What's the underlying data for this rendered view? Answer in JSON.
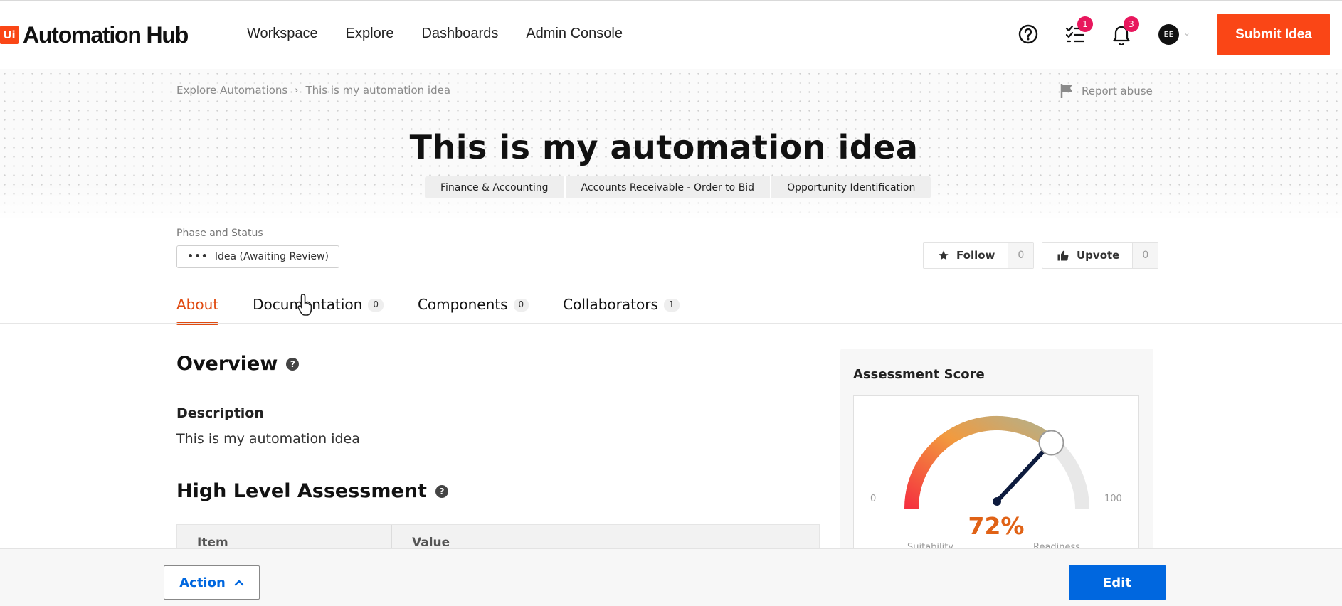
{
  "header": {
    "logo_mark": "Ui",
    "logo_text": "Automation Hub",
    "nav": [
      "Workspace",
      "Explore",
      "Dashboards",
      "Admin Console"
    ],
    "tasks_badge": "1",
    "notifications_badge": "3",
    "avatar_initials": "EE",
    "submit_label": "Submit Idea"
  },
  "breadcrumb": {
    "root": "Explore Automations",
    "current": "This is my automation idea"
  },
  "report_label": "Report abuse",
  "title": "This is my automation idea",
  "categories": [
    "Finance & Accounting",
    "Accounts Receivable - Order to Bid",
    "Opportunity Identification"
  ],
  "phase": {
    "label": "Phase and Status",
    "value": "Idea (Awaiting Review)"
  },
  "follow": {
    "label": "Follow",
    "count": "0"
  },
  "upvote": {
    "label": "Upvote",
    "count": "0"
  },
  "tabs": [
    {
      "label": "About",
      "count": ""
    },
    {
      "label": "Documentation",
      "count": "0"
    },
    {
      "label": "Components",
      "count": "0"
    },
    {
      "label": "Collaborators",
      "count": "1"
    }
  ],
  "overview": {
    "heading": "Overview",
    "description_label": "Description",
    "description_text": "This is my automation idea"
  },
  "hla": {
    "heading": "High Level Assessment",
    "col_item": "Item",
    "col_value": "Value"
  },
  "assessment": {
    "title": "Assessment Score",
    "score_percent": 72,
    "score_label": "72%",
    "min": "0",
    "max": "100",
    "left_caption": "Suitability",
    "right_caption": "Readiness"
  },
  "footer": {
    "action_label": "Action",
    "edit_label": "Edit"
  },
  "colors": {
    "brand": "#fa4616",
    "accent_blue": "#0067df",
    "tab_active": "#e04a10"
  }
}
